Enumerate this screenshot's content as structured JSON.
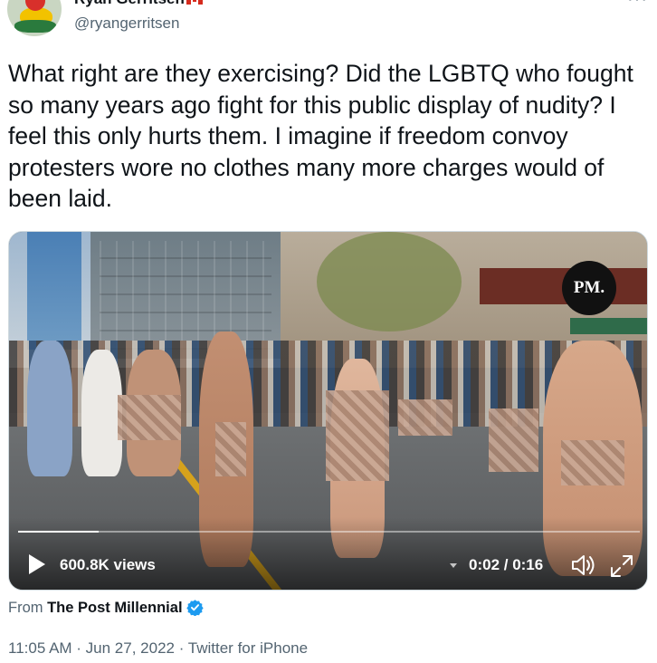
{
  "author": {
    "display_name": "Ryan Gerritsen",
    "handle": "@ryangerritsen",
    "flag": "canada-flag-icon"
  },
  "tweet": {
    "text": "What right are they exercising? Did the LGBTQ who fought so many years ago fight for this public display of nudity? I feel this only hurts them. I imagine if freedom convoy protesters wore no clothes many more charges would of been laid."
  },
  "media": {
    "type": "video",
    "logo_text": "PM.",
    "views": "600.8K views",
    "time": "0:02 / 0:16",
    "progress": 0.13,
    "icons": {
      "play": "play-icon",
      "volume": "volume-icon",
      "fullscreen": "fullscreen-icon"
    }
  },
  "source": {
    "prefix": "From",
    "name": "The Post Millennial",
    "verified": true
  },
  "meta": {
    "timestamp": "11:05 AM · Jun 27, 2022 · Twitter for iPhone"
  },
  "colors": {
    "text_primary": "#0f1419",
    "text_secondary": "#536471",
    "verified_blue": "#1d9bf0"
  }
}
